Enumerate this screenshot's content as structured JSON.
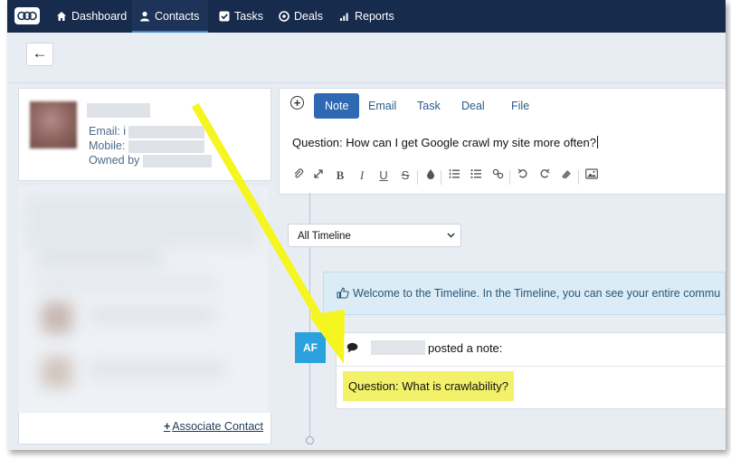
{
  "nav": {
    "items": [
      {
        "label": "Dashboard",
        "icon": "home-icon"
      },
      {
        "label": "Contacts",
        "icon": "person-icon",
        "active": true
      },
      {
        "label": "Tasks",
        "icon": "checkbox-icon"
      },
      {
        "label": "Deals",
        "icon": "target-icon"
      },
      {
        "label": "Reports",
        "icon": "bar-chart-icon"
      }
    ]
  },
  "back_symbol": "←",
  "contact": {
    "email_label": "Email: i",
    "mobile_label": "Mobile:",
    "owned_label": "Owned by"
  },
  "associate_label": "Associate Contact",
  "editor": {
    "tabs": [
      "Note",
      "Email",
      "Task",
      "Deal",
      "File"
    ],
    "active_tab": "Note",
    "text": "Question: How can I get Google crawl my site more often?"
  },
  "timeline": {
    "filter_value": "All Timeline",
    "welcome_text": "Welcome to the Timeline. In the Timeline, you can see your entire commu",
    "badge": "AF",
    "posted_text": "posted a note:",
    "note_text": "Question: What is crawlability?"
  },
  "colors": {
    "nav_bg": "#172b4d",
    "accent": "#2f69b3",
    "badge": "#2aa2dd",
    "highlight": "#f3f16a",
    "arrow": "#f5f51f"
  }
}
